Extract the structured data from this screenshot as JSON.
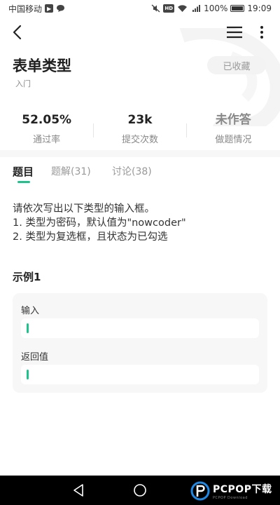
{
  "status_bar": {
    "carrier": "中国移动",
    "hd_label": "HD",
    "signal_label": "4G",
    "battery_percent": "100%",
    "time": "19:09"
  },
  "problem": {
    "title": "表单类型",
    "level": "入门",
    "favorite_label": "已收藏"
  },
  "stats": [
    {
      "value": "52.05%",
      "label": "通过率"
    },
    {
      "value": "23k",
      "label": "提交次数"
    },
    {
      "value": "未作答",
      "label": "做题情况"
    }
  ],
  "tabs": [
    {
      "label": "题目",
      "active": true
    },
    {
      "label": "题解(31)",
      "active": false
    },
    {
      "label": "讨论(38)",
      "active": false
    }
  ],
  "description": {
    "lines": [
      "请依次写出以下类型的输入框。",
      "1. 类型为密码，默认值为\"nowcoder\"",
      "2. 类型为复选框，且状态为已勾选"
    ]
  },
  "example": {
    "title": "示例1",
    "input_label": "输入",
    "output_label": "返回值"
  },
  "watermark": {
    "logo_text": "PCPOP下载",
    "logo_subtext": "PCPOP Download"
  },
  "colors": {
    "accent": "#1ec38b",
    "navbar": "#000000",
    "card_bg": "#f7f7f7"
  }
}
